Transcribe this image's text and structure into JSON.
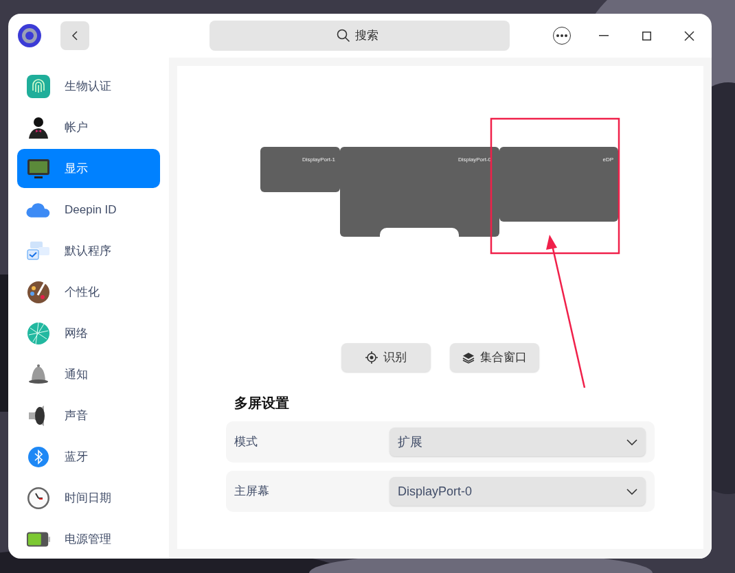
{
  "window": {
    "search": {
      "placeholder": "搜索"
    }
  },
  "sidebar": {
    "items": [
      {
        "label": "生物认证",
        "selected": false
      },
      {
        "label": "帐户",
        "selected": false
      },
      {
        "label": "显示",
        "selected": true
      },
      {
        "label": "Deepin ID",
        "selected": false
      },
      {
        "label": "默认程序",
        "selected": false
      },
      {
        "label": "个性化",
        "selected": false
      },
      {
        "label": "网络",
        "selected": false
      },
      {
        "label": "通知",
        "selected": false
      },
      {
        "label": "声音",
        "selected": false
      },
      {
        "label": "蓝牙",
        "selected": false
      },
      {
        "label": "时间日期",
        "selected": false
      },
      {
        "label": "电源管理",
        "selected": false
      }
    ]
  },
  "display": {
    "monitors": [
      {
        "name": "DisplayPort-1"
      },
      {
        "name": "DisplayPort-0"
      },
      {
        "name": "eDP"
      }
    ],
    "buttons": [
      {
        "label": "识别",
        "kind": "identify"
      },
      {
        "label": "集合窗口",
        "kind": "gather"
      }
    ],
    "section_title": "多屏设置",
    "settings": [
      {
        "label": "模式",
        "value": "扩展"
      },
      {
        "label": "主屏幕",
        "value": "DisplayPort-0"
      }
    ]
  }
}
